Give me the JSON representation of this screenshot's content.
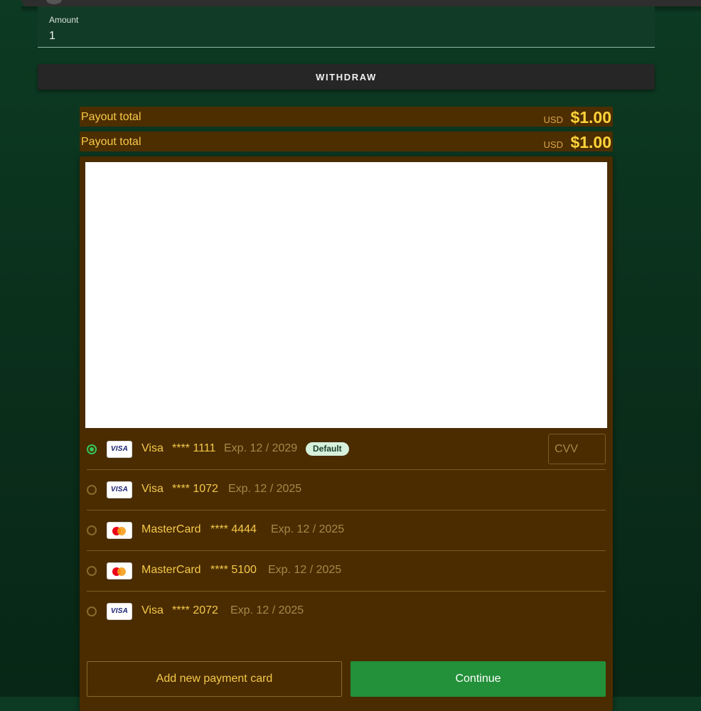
{
  "amount_field": {
    "label": "Amount",
    "value": "1"
  },
  "withdraw_button": {
    "label": "WITHDRAW"
  },
  "payout_rows": [
    {
      "label": "Payout total",
      "currency": "USD",
      "amount": "$1.00"
    },
    {
      "label": "Payout total",
      "currency": "USD",
      "amount": "$1.00"
    }
  ],
  "cards": [
    {
      "brand": "Visa",
      "logo": "visa-logo-icon",
      "logo_text": "VISA",
      "number": "**** 1111",
      "exp": "Exp. 12 / 2029",
      "selected": true,
      "badge": "Default"
    },
    {
      "brand": "Visa",
      "logo": "visa-logo-icon",
      "logo_text": "VISA",
      "number": "**** 1072",
      "exp": "Exp. 12 / 2025",
      "selected": false
    },
    {
      "brand": "MasterCard",
      "logo": "mastercard-logo-icon",
      "number": "**** 4444",
      "exp": "Exp. 12 / 2025",
      "selected": false
    },
    {
      "brand": "MasterCard",
      "logo": "mastercard-logo-icon",
      "number": "**** 5100",
      "exp": "Exp. 12 / 2025",
      "selected": false
    },
    {
      "brand": "Visa",
      "logo": "visa-logo-icon",
      "logo_text": "VISA",
      "number": "**** 2072",
      "exp": "Exp. 12 / 2025",
      "selected": false
    }
  ],
  "cvv": {
    "placeholder": "CVV"
  },
  "actions": {
    "add_card_label": "Add new payment card",
    "continue_label": "Continue"
  },
  "colors": {
    "page_background": "#0a2d1a",
    "panel_background": "#4a2c00",
    "gold_text": "#f6c94a",
    "amount_highlight": "#ffd43b",
    "continue_green": "#23903a",
    "radio_selected": "#34c759"
  }
}
